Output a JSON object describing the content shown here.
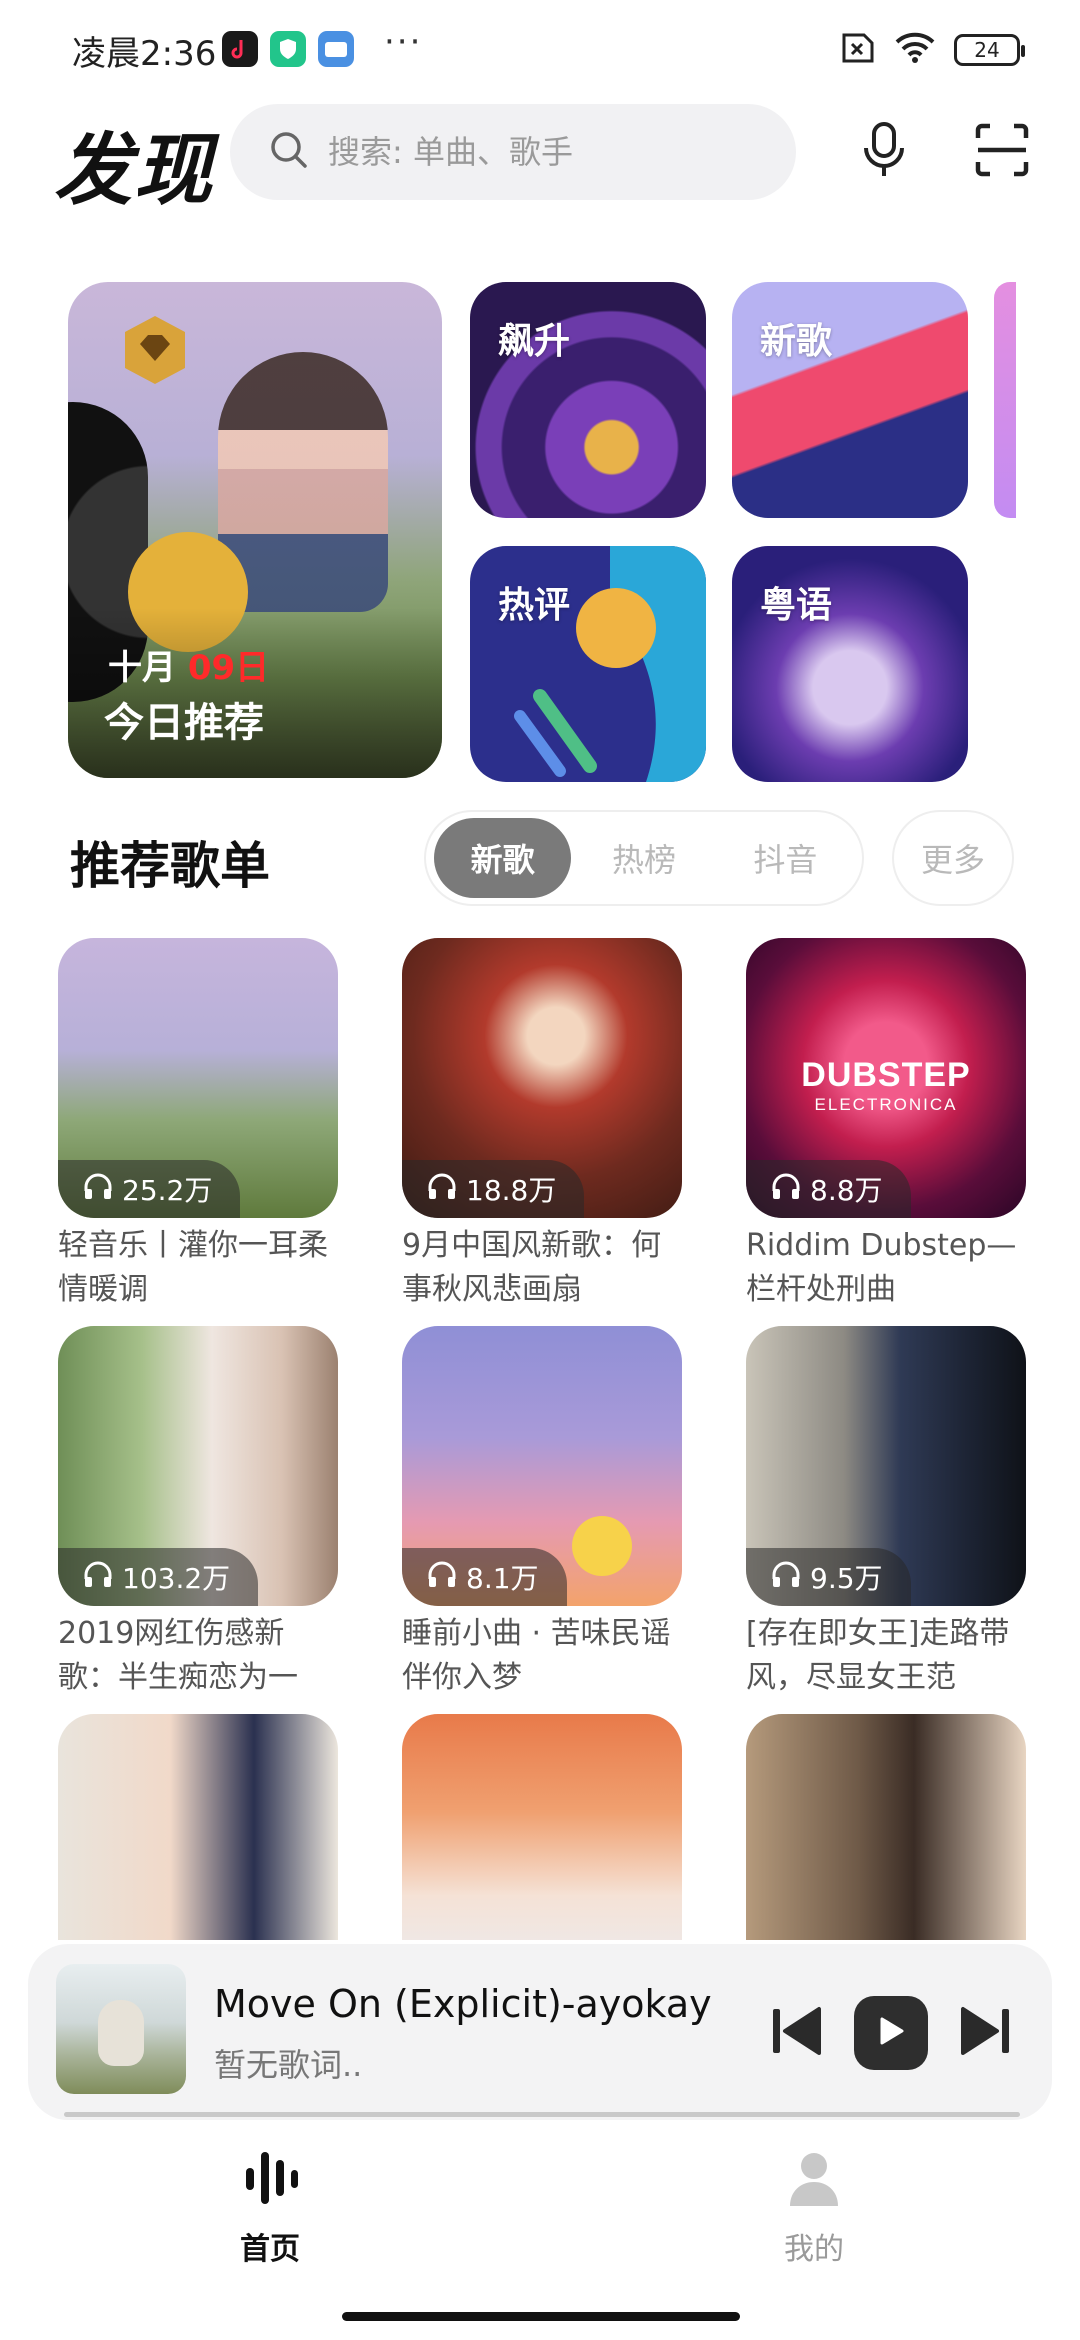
{
  "status": {
    "time": "凌晨2:36",
    "battery": "24"
  },
  "header": {
    "title": "发现",
    "search_placeholder": "搜索: 单曲、歌手"
  },
  "featured": {
    "date_month": "十月",
    "date_day": "09日",
    "today_label": "今日推荐",
    "tiles": [
      "飙升",
      "新歌",
      "热评",
      "粤语"
    ]
  },
  "section": {
    "title": "推荐歌单",
    "tabs": [
      "新歌",
      "热榜",
      "抖音"
    ],
    "active_tab": "新歌",
    "more": "更多"
  },
  "playlists": [
    {
      "plays": "25.2万",
      "title": "轻音乐丨灌你一耳柔情暖调"
    },
    {
      "plays": "18.8万",
      "title": "9月中国风新歌：何事秋风悲画扇"
    },
    {
      "plays": "8.8万",
      "title": "Riddim Dubstep—栏杆处刑曲",
      "art_text": "DUBSTEP",
      "art_sub": "ELECTRONICA"
    },
    {
      "plays": "103.2万",
      "title": "2019网红伤感新歌：半生痴恋为一"
    },
    {
      "plays": "8.1万",
      "title": "睡前小曲 · 苦味民谣伴你入梦"
    },
    {
      "plays": "9.5万",
      "title": "[存在即女王]走路带风，尽显女王范"
    },
    {
      "plays": "",
      "title": ""
    },
    {
      "plays": "",
      "title": ""
    },
    {
      "plays": "",
      "title": ""
    }
  ],
  "player": {
    "song": "Move On (Explicit)-ayokay",
    "lyric": "暂无歌词..",
    "progress": 0
  },
  "nav": {
    "home": "首页",
    "mine": "我的",
    "active": "home"
  }
}
